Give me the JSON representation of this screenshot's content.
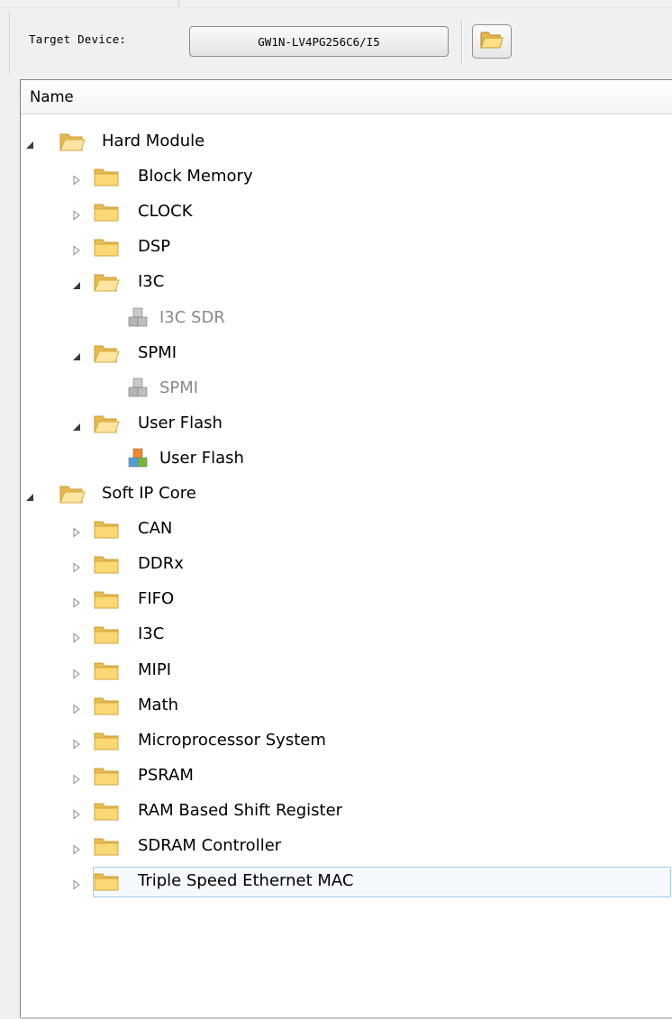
{
  "toolbar": {
    "target_device_label": "Target Device:",
    "target_device_value": "GW1N-LV4PG256C6/I5",
    "browse_icon": "folder-open-icon"
  },
  "tree": {
    "column_header": "Name",
    "nodes": [
      {
        "label": "Hard Module",
        "level": 0,
        "state": "expanded",
        "icon": "folder-open-icon"
      },
      {
        "label": "Block Memory",
        "level": 1,
        "state": "collapsed",
        "icon": "folder-icon"
      },
      {
        "label": "CLOCK",
        "level": 1,
        "state": "collapsed",
        "icon": "folder-icon"
      },
      {
        "label": "DSP",
        "level": 1,
        "state": "collapsed",
        "icon": "folder-icon"
      },
      {
        "label": "I3C",
        "level": 1,
        "state": "expanded",
        "icon": "folder-open-icon"
      },
      {
        "label": "I3C SDR",
        "level": 2,
        "state": "leaf",
        "icon": "ip-cubes-icon",
        "disabled": true
      },
      {
        "label": "SPMI",
        "level": 1,
        "state": "expanded",
        "icon": "folder-open-icon"
      },
      {
        "label": "SPMI",
        "level": 2,
        "state": "leaf",
        "icon": "ip-cubes-icon",
        "disabled": true
      },
      {
        "label": "User Flash",
        "level": 1,
        "state": "expanded",
        "icon": "folder-open-icon"
      },
      {
        "label": "User Flash",
        "level": 2,
        "state": "leaf",
        "icon": "ip-cubes-icon",
        "disabled": false
      },
      {
        "label": "Soft IP Core",
        "level": 0,
        "state": "expanded",
        "icon": "folder-open-icon"
      },
      {
        "label": "CAN",
        "level": 1,
        "state": "collapsed",
        "icon": "folder-icon"
      },
      {
        "label": "DDRx",
        "level": 1,
        "state": "collapsed",
        "icon": "folder-icon"
      },
      {
        "label": "FIFO",
        "level": 1,
        "state": "collapsed",
        "icon": "folder-icon"
      },
      {
        "label": "I3C",
        "level": 1,
        "state": "collapsed",
        "icon": "folder-icon"
      },
      {
        "label": "MIPI",
        "level": 1,
        "state": "collapsed",
        "icon": "folder-icon"
      },
      {
        "label": "Math",
        "level": 1,
        "state": "collapsed",
        "icon": "folder-icon"
      },
      {
        "label": "Microprocessor System",
        "level": 1,
        "state": "collapsed",
        "icon": "folder-icon"
      },
      {
        "label": "PSRAM",
        "level": 1,
        "state": "collapsed",
        "icon": "folder-icon"
      },
      {
        "label": "RAM Based Shift Register",
        "level": 1,
        "state": "collapsed",
        "icon": "folder-icon"
      },
      {
        "label": "SDRAM Controller",
        "level": 1,
        "state": "collapsed",
        "icon": "folder-icon"
      },
      {
        "label": "Triple Speed Ethernet MAC",
        "level": 1,
        "state": "collapsed",
        "icon": "folder-icon",
        "selected": true
      }
    ]
  },
  "colors": {
    "folder": "#f7d86b",
    "folder_dark": "#d9a93c",
    "selection_border": "#a8cbe8",
    "disabled_text": "#8a8a8a"
  }
}
